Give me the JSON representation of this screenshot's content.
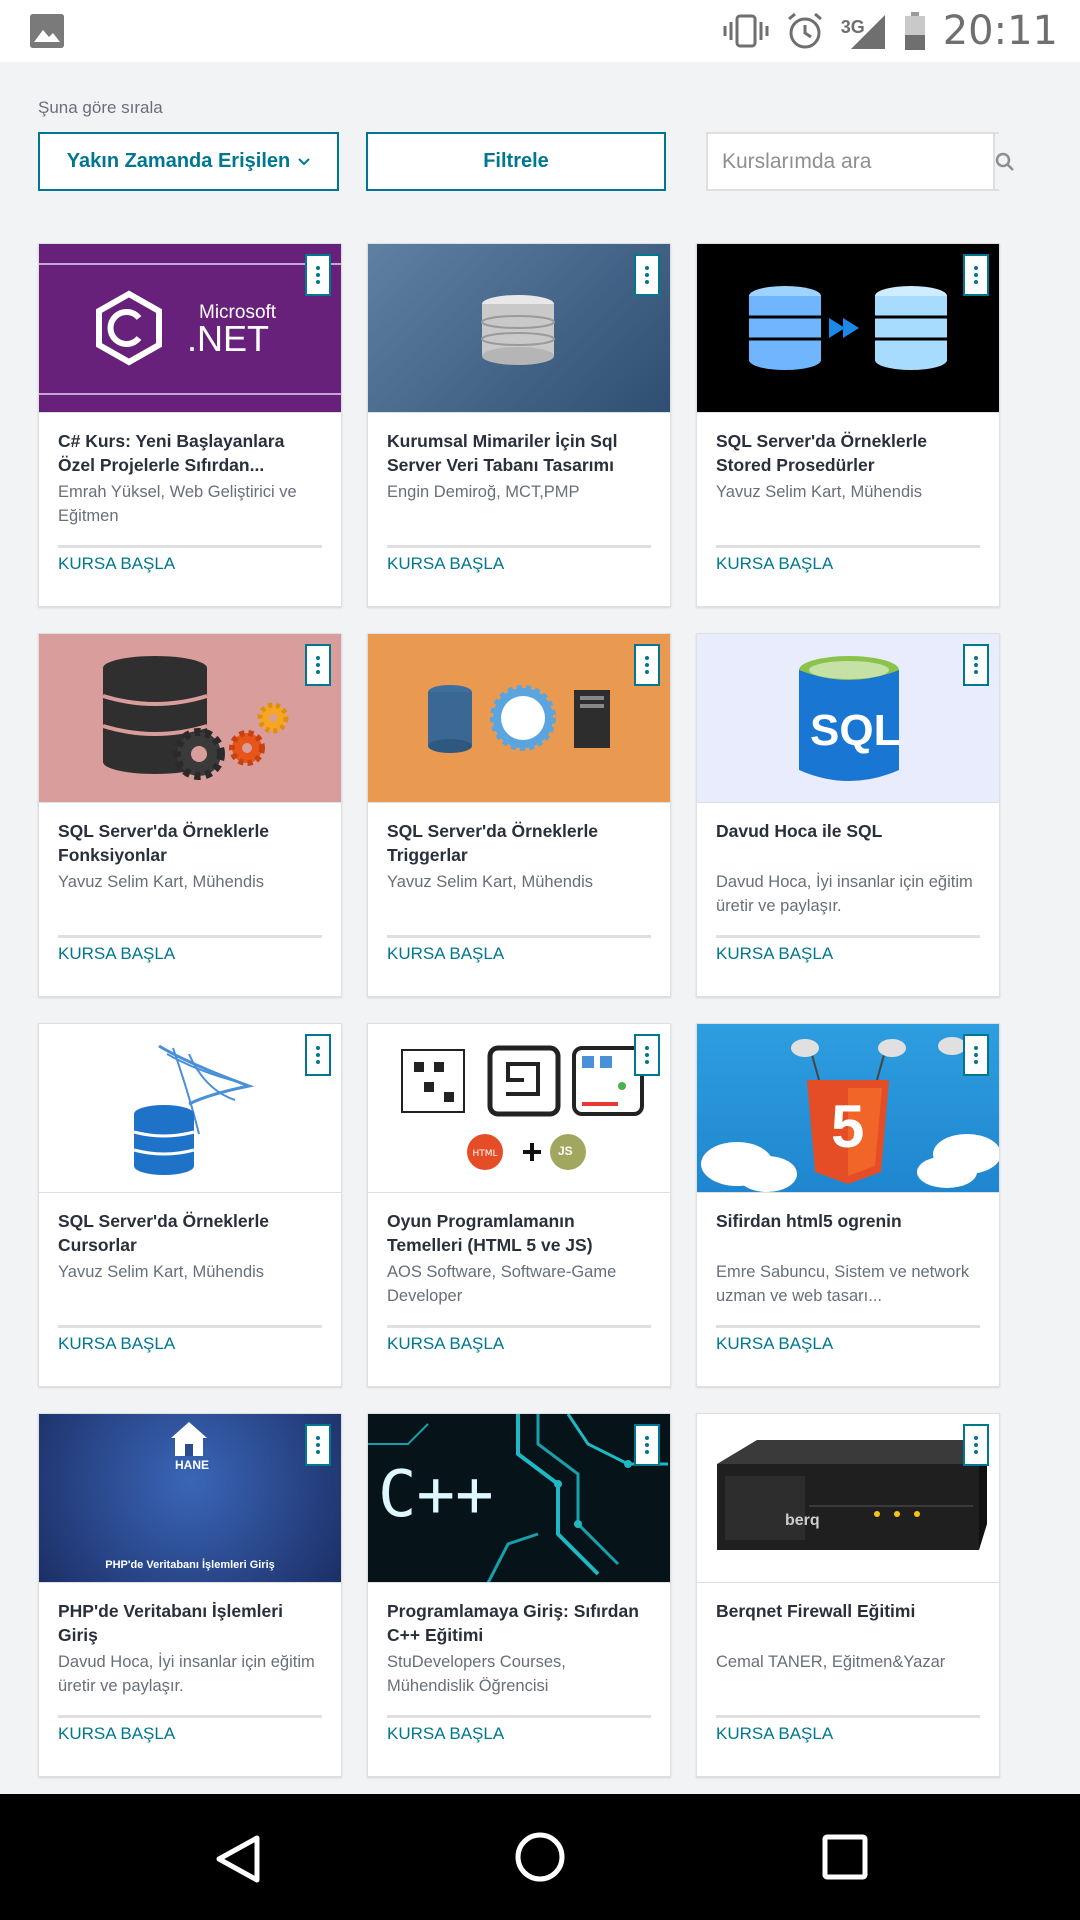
{
  "status_bar": {
    "time": "20:11",
    "network": "3G"
  },
  "toolbar": {
    "sort_label": "Şuna göre sırala",
    "sort_value": "Yakın Zamanda Erişilen",
    "filter_label": "Filtrele",
    "search_placeholder": "Kurslarımda ara"
  },
  "courses": [
    {
      "title": "C# Kurs: Yeni Başlayanlara Özel Projelerle Sıfırdan...",
      "author": "Emrah Yüksel, Web Geliştirici ve Eğitmen",
      "cta": "KURSA BAŞLA",
      "thumb_text": "Microsoft",
      "thumb_text2": ".NET"
    },
    {
      "title": "Kurumsal Mimariler İçin Sql Server Veri Tabanı Tasarımı",
      "author": "Engin Demiroğ, MCT,PMP",
      "cta": "KURSA BAŞLA"
    },
    {
      "title": "SQL Server'da Örneklerle Stored Prosedürler",
      "author": "Yavuz Selim Kart, Mühendis",
      "cta": "KURSA BAŞLA"
    },
    {
      "title": "SQL Server'da Örneklerle Fonksiyonlar",
      "author": "Yavuz Selim Kart, Mühendis",
      "cta": "KURSA BAŞLA"
    },
    {
      "title": "SQL Server'da Örneklerle Triggerlar",
      "author": "Yavuz Selim Kart, Mühendis",
      "cta": "KURSA BAŞLA"
    },
    {
      "title": "Davud Hoca ile SQL",
      "author": "Davud Hoca, İyi insanlar için eğitim üretir ve paylaşır.",
      "cta": "KURSA BAŞLA",
      "thumb_text": "SQL"
    },
    {
      "title": "SQL Server'da Örneklerle Cursorlar",
      "author": "Yavuz Selim Kart, Mühendis",
      "cta": "KURSA BAŞLA"
    },
    {
      "title": "Oyun Programlamanın Temelleri (HTML 5 ve JS)",
      "author": "AOS Software, Software-Game Developer",
      "cta": "KURSA BAŞLA",
      "thumb_text": "JS"
    },
    {
      "title": "Sifirdan html5 ogrenin",
      "author": "Emre Sabuncu, Sistem ve network uzman ve web tasarı...",
      "cta": "KURSA BAŞLA",
      "thumb_text": "5"
    },
    {
      "title": "PHP'de Veritabanı İşlemleri Giriş",
      "author": "Davud Hoca, İyi insanlar için eğitim üretir ve paylaşır.",
      "cta": "KURSA BAŞLA",
      "thumb_text": "HANE",
      "thumb_text2": "PHP'de Veritabanı İşlemleri Giriş"
    },
    {
      "title": "Programlamaya Giriş: Sıfırdan C++ Eğitimi",
      "author": "StuDevelopers Courses, Mühendislik Öğrencisi",
      "cta": "KURSA BAŞLA",
      "thumb_text": "C++"
    },
    {
      "title": "Berqnet Firewall Eğitimi",
      "author": "Cemal TANER, Eğitmen&Yazar",
      "cta": "KURSA BAŞLA",
      "thumb_text": "berq"
    }
  ],
  "colors": {
    "accent": "#007791",
    "text": "#29303b",
    "muted": "#686f7a"
  },
  "icons": {
    "sort_caret": "chevron-down-icon",
    "search": "search-icon",
    "card_menu": "more-vertical-icon"
  }
}
